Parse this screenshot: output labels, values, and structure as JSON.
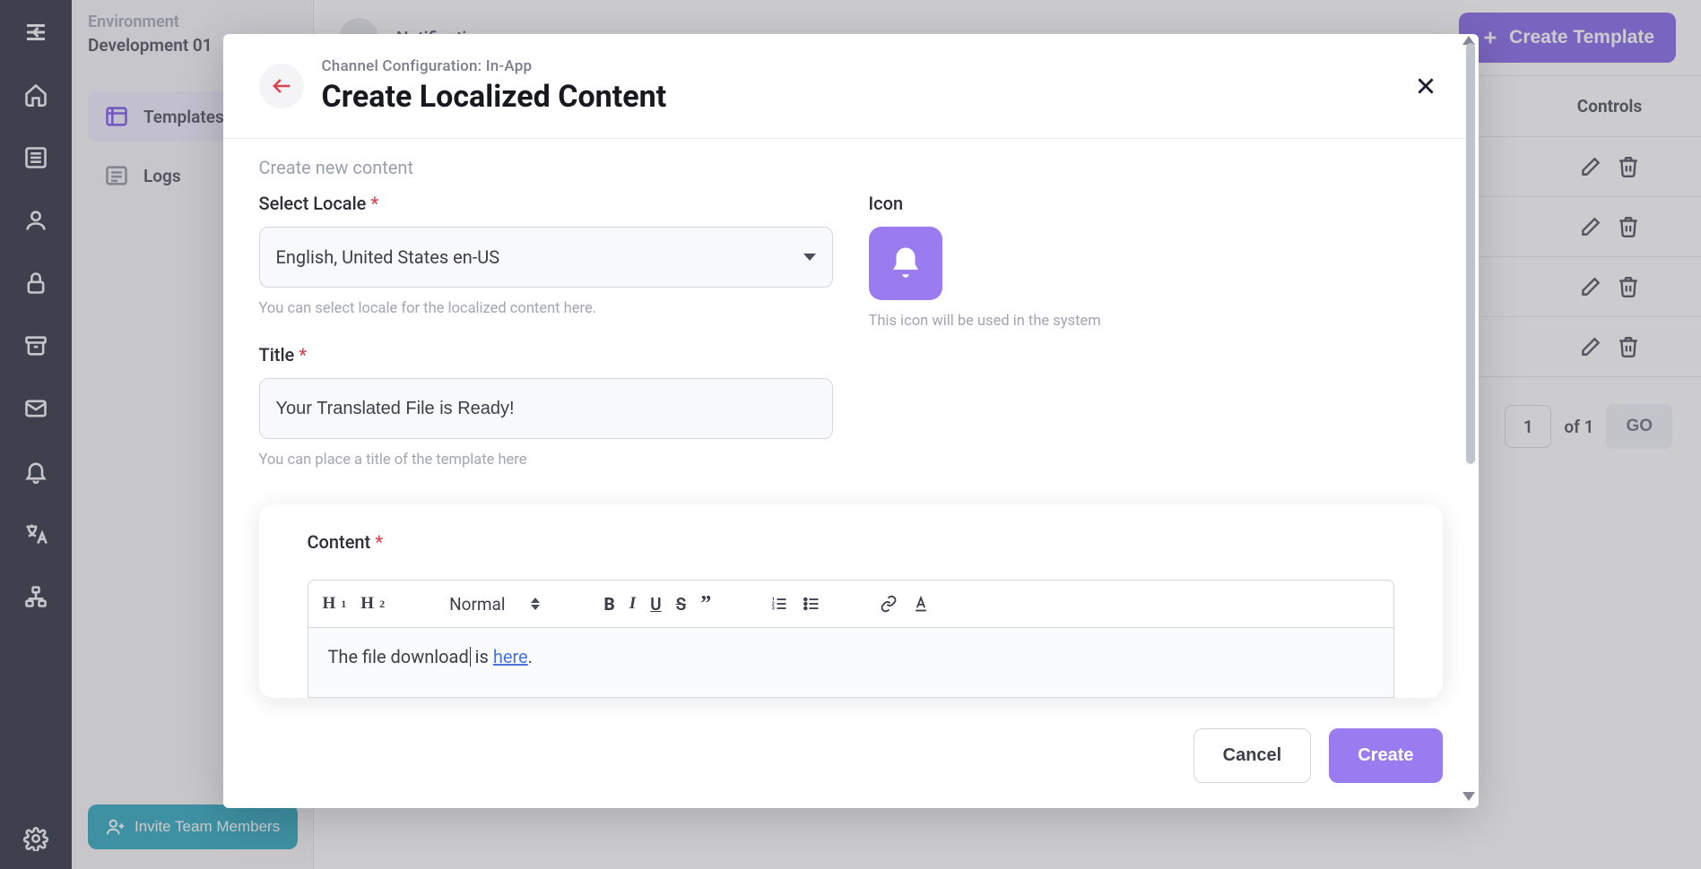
{
  "env": {
    "label": "Environment",
    "name": "Development 01"
  },
  "sidemenu": {
    "templates": "Templates",
    "logs": "Logs"
  },
  "invite_label": "Invite Team Members",
  "header": {
    "title": "Notifications",
    "create_template": "Create Template"
  },
  "table": {
    "controls_header": "Controls",
    "rows": 4
  },
  "pager": {
    "current": "1",
    "of_label": "of 1",
    "go": "GO"
  },
  "modal": {
    "crumb": "Channel Configuration: In-App",
    "title": "Create Localized Content",
    "section": "Create new content",
    "locale": {
      "label": "Select Locale",
      "value": "English, United States en-US",
      "help": "You can select locale for the localized content here."
    },
    "icon": {
      "label": "Icon",
      "help": "This icon will be used in the system",
      "name": "bell-icon"
    },
    "title_field": {
      "label": "Title",
      "value": "Your Translated File is Ready!",
      "help": "You can place a title of the template here"
    },
    "content": {
      "label": "Content",
      "format": "Normal",
      "text_prefix": "The file download",
      "text_middle": " is ",
      "link_text": "here",
      "text_suffix": "."
    },
    "footer": {
      "cancel": "Cancel",
      "create": "Create"
    }
  }
}
